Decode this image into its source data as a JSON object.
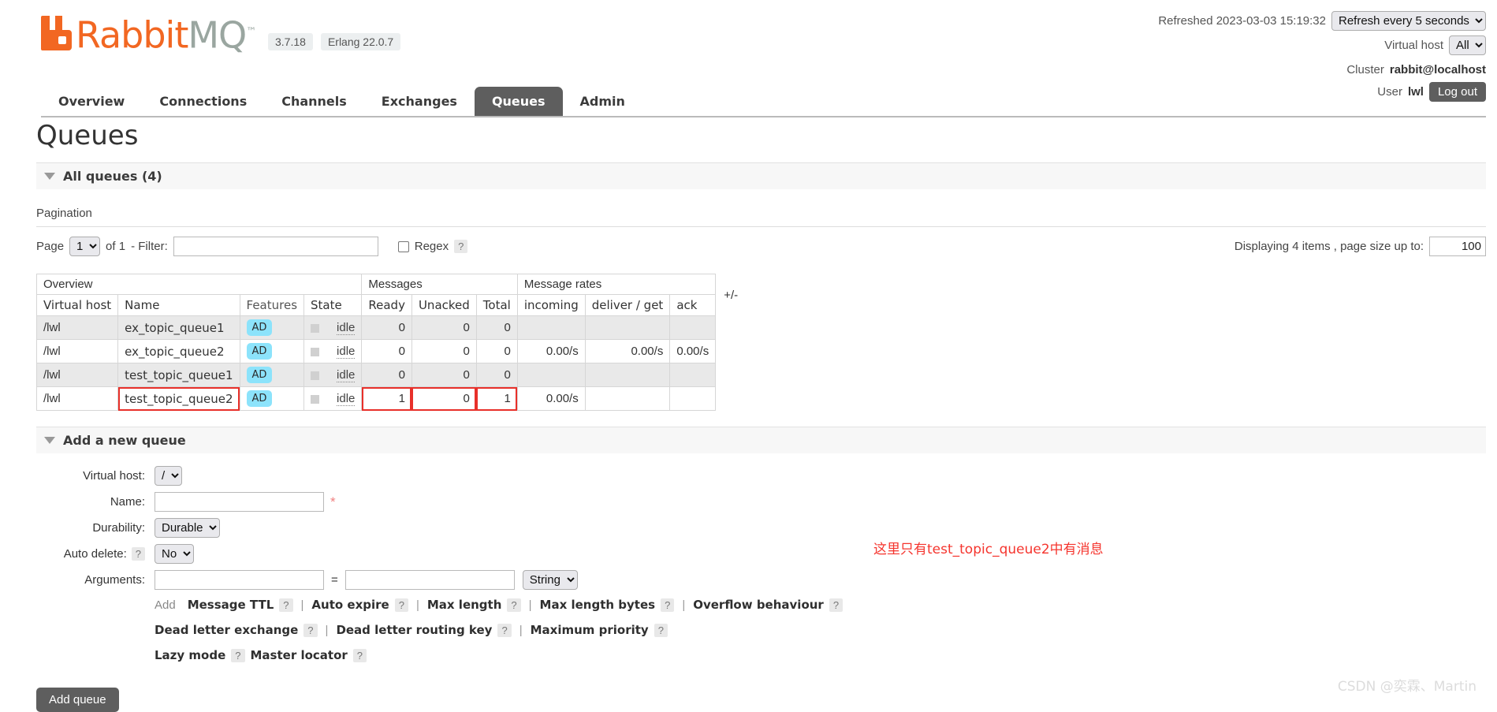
{
  "header": {
    "logo_rabbit": "Rabbit",
    "logo_mq": "MQ",
    "logo_tm": "™",
    "version": "3.7.18",
    "erlang": "Erlang 22.0.7",
    "refreshed_label": "Refreshed 2023-03-03 15:19:32",
    "refresh_select": "Refresh every 5 seconds",
    "vhost_label": "Virtual host",
    "vhost_select": "All",
    "cluster_label": "Cluster",
    "cluster_value": "rabbit@localhost",
    "user_label": "User",
    "user_value": "lwl",
    "logout_label": "Log out"
  },
  "nav": {
    "items": [
      {
        "label": "Overview",
        "active": false
      },
      {
        "label": "Connections",
        "active": false
      },
      {
        "label": "Channels",
        "active": false
      },
      {
        "label": "Exchanges",
        "active": false
      },
      {
        "label": "Queues",
        "active": true
      },
      {
        "label": "Admin",
        "active": false
      }
    ]
  },
  "page": {
    "title": "Queues",
    "all_queues_label": "All queues (4)",
    "pagination_label": "Pagination"
  },
  "pagination": {
    "page_label": "Page",
    "page_value": "1",
    "of_label": "of 1",
    "filter_label": "- Filter:",
    "filter_value": "",
    "regex_label": "Regex",
    "help": "?",
    "displaying_label": "Displaying 4 items , page size up to:",
    "page_size": "100"
  },
  "table": {
    "group_headers": [
      {
        "label": "Overview",
        "span": 4
      },
      {
        "label": "Messages",
        "span": 3
      },
      {
        "label": "Message rates",
        "span": 3
      }
    ],
    "plusminus": "+/-",
    "columns": [
      {
        "label": "Virtual host",
        "sortable": true,
        "align": "left"
      },
      {
        "label": "Name",
        "sortable": true,
        "align": "left"
      },
      {
        "label": "Features",
        "sortable": false,
        "align": "left"
      },
      {
        "label": "State",
        "sortable": true,
        "align": "left"
      },
      {
        "label": "Ready",
        "sortable": true,
        "align": "right"
      },
      {
        "label": "Unacked",
        "sortable": true,
        "align": "right"
      },
      {
        "label": "Total",
        "sortable": true,
        "align": "right"
      },
      {
        "label": "incoming",
        "sortable": true,
        "align": "left"
      },
      {
        "label": "deliver / get",
        "sortable": true,
        "align": "left"
      },
      {
        "label": "ack",
        "sortable": true,
        "align": "left"
      }
    ],
    "rows": [
      {
        "vhost": "/lwl",
        "name": "ex_topic_queue1",
        "features": "AD",
        "state": "idle",
        "ready": "0",
        "unacked": "0",
        "total": "0",
        "incoming": "",
        "deliver_get": "",
        "ack": "",
        "highlight_name": false,
        "highlight_messages": false
      },
      {
        "vhost": "/lwl",
        "name": "ex_topic_queue2",
        "features": "AD",
        "state": "idle",
        "ready": "0",
        "unacked": "0",
        "total": "0",
        "incoming": "0.00/s",
        "deliver_get": "0.00/s",
        "ack": "0.00/s",
        "highlight_name": false,
        "highlight_messages": false
      },
      {
        "vhost": "/lwl",
        "name": "test_topic_queue1",
        "features": "AD",
        "state": "idle",
        "ready": "0",
        "unacked": "0",
        "total": "0",
        "incoming": "",
        "deliver_get": "",
        "ack": "",
        "highlight_name": false,
        "highlight_messages": false
      },
      {
        "vhost": "/lwl",
        "name": "test_topic_queue2",
        "features": "AD",
        "state": "idle",
        "ready": "1",
        "unacked": "0",
        "total": "1",
        "incoming": "0.00/s",
        "deliver_get": "",
        "ack": "",
        "highlight_name": true,
        "highlight_messages": true
      }
    ]
  },
  "annotation": "这里只有test_topic_queue2中有消息",
  "add_queue": {
    "section_label": "Add a new queue",
    "vhost_label": "Virtual host:",
    "vhost_value": "/",
    "name_label": "Name:",
    "name_value": "",
    "required_mark": "*",
    "durability_label": "Durability:",
    "durability_value": "Durable",
    "autodelete_label": "Auto delete:",
    "autodelete_value": "No",
    "autodelete_help": "?",
    "arguments_label": "Arguments:",
    "arg_key": "",
    "arg_value": "",
    "equals": "=",
    "arg_type": "String",
    "add_word": "Add",
    "presets": [
      [
        {
          "label": "Message TTL",
          "help": "?",
          "sep": true
        },
        {
          "label": "Auto expire",
          "help": "?",
          "sep": true
        },
        {
          "label": "Max length",
          "help": "?",
          "sep": true
        },
        {
          "label": "Max length bytes",
          "help": "?",
          "sep": true
        },
        {
          "label": "Overflow behaviour",
          "help": "?",
          "sep": false
        }
      ],
      [
        {
          "label": "Dead letter exchange",
          "help": "?",
          "sep": true
        },
        {
          "label": "Dead letter routing key",
          "help": "?",
          "sep": true
        },
        {
          "label": "Maximum priority",
          "help": "?",
          "sep": false
        }
      ],
      [
        {
          "label": "Lazy mode",
          "help": "?",
          "sep": false
        },
        {
          "label": "Master locator",
          "help": "?",
          "sep": false
        }
      ]
    ],
    "submit_label": "Add queue"
  },
  "watermark": "CSDN @奕霖、Martin",
  "colors": {
    "brand_orange": "#f26722",
    "brand_gray": "#9aa6a0",
    "active_tab": "#5e5e5e",
    "badge_cyan": "#8ce3fb",
    "annotation_red": "#f5352e"
  }
}
